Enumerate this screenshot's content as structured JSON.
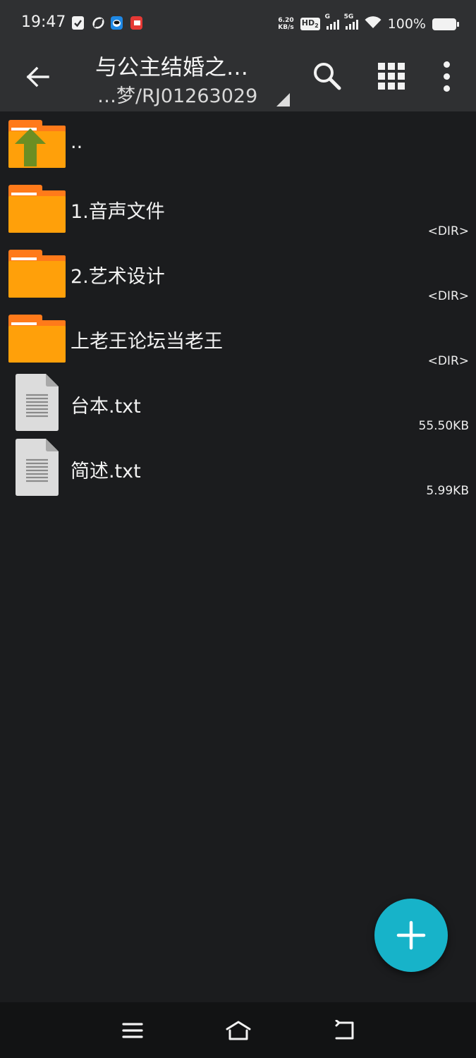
{
  "status_bar": {
    "time": "19:47",
    "notification_icons": [
      {
        "icon": "clipboard-check-icon",
        "color": "#f2f2f2"
      },
      {
        "icon": "link-sync-icon",
        "color": "#f2f2f2"
      },
      {
        "icon": "app-blue-face-icon",
        "color": "#1e88e5"
      },
      {
        "icon": "app-red-icon",
        "color": "#e53935"
      }
    ],
    "net_speed_value": "6.20",
    "net_speed_unit": "KB/s",
    "hd_label": "HD",
    "hd_index": "2",
    "signal1_label": "G",
    "signal2_label": "5G",
    "battery_percent": "100%"
  },
  "toolbar": {
    "back_icon": "arrow-left-icon",
    "title": "与公主结婚之…",
    "subtitle": "…梦/RJ01263029",
    "actions": [
      "search-icon",
      "grid-view-icon",
      "more-vert-icon"
    ]
  },
  "files": [
    {
      "name": "..",
      "meta": "",
      "type": "parent"
    },
    {
      "name": "1.音声文件",
      "meta": "<DIR>",
      "type": "folder"
    },
    {
      "name": "2.艺术设计",
      "meta": "<DIR>",
      "type": "folder"
    },
    {
      "name": "上老王论坛当老王",
      "meta": "<DIR>",
      "type": "folder"
    },
    {
      "name": "台本.txt",
      "meta": "55.50KB",
      "type": "text"
    },
    {
      "name": "简述.txt",
      "meta": "5.99KB",
      "type": "text"
    }
  ],
  "fab": {
    "icon": "plus-icon",
    "color": "#17b3c9"
  },
  "nav_bar": {
    "buttons": [
      "menu-icon",
      "home-icon",
      "back-nav-icon"
    ]
  },
  "colors": {
    "background": "#1b1c1e",
    "toolbar": "#2f3032",
    "folder_front": "#ffa00a",
    "folder_back": "#ff7a1a",
    "parent_arrow": "#6b8e23"
  }
}
